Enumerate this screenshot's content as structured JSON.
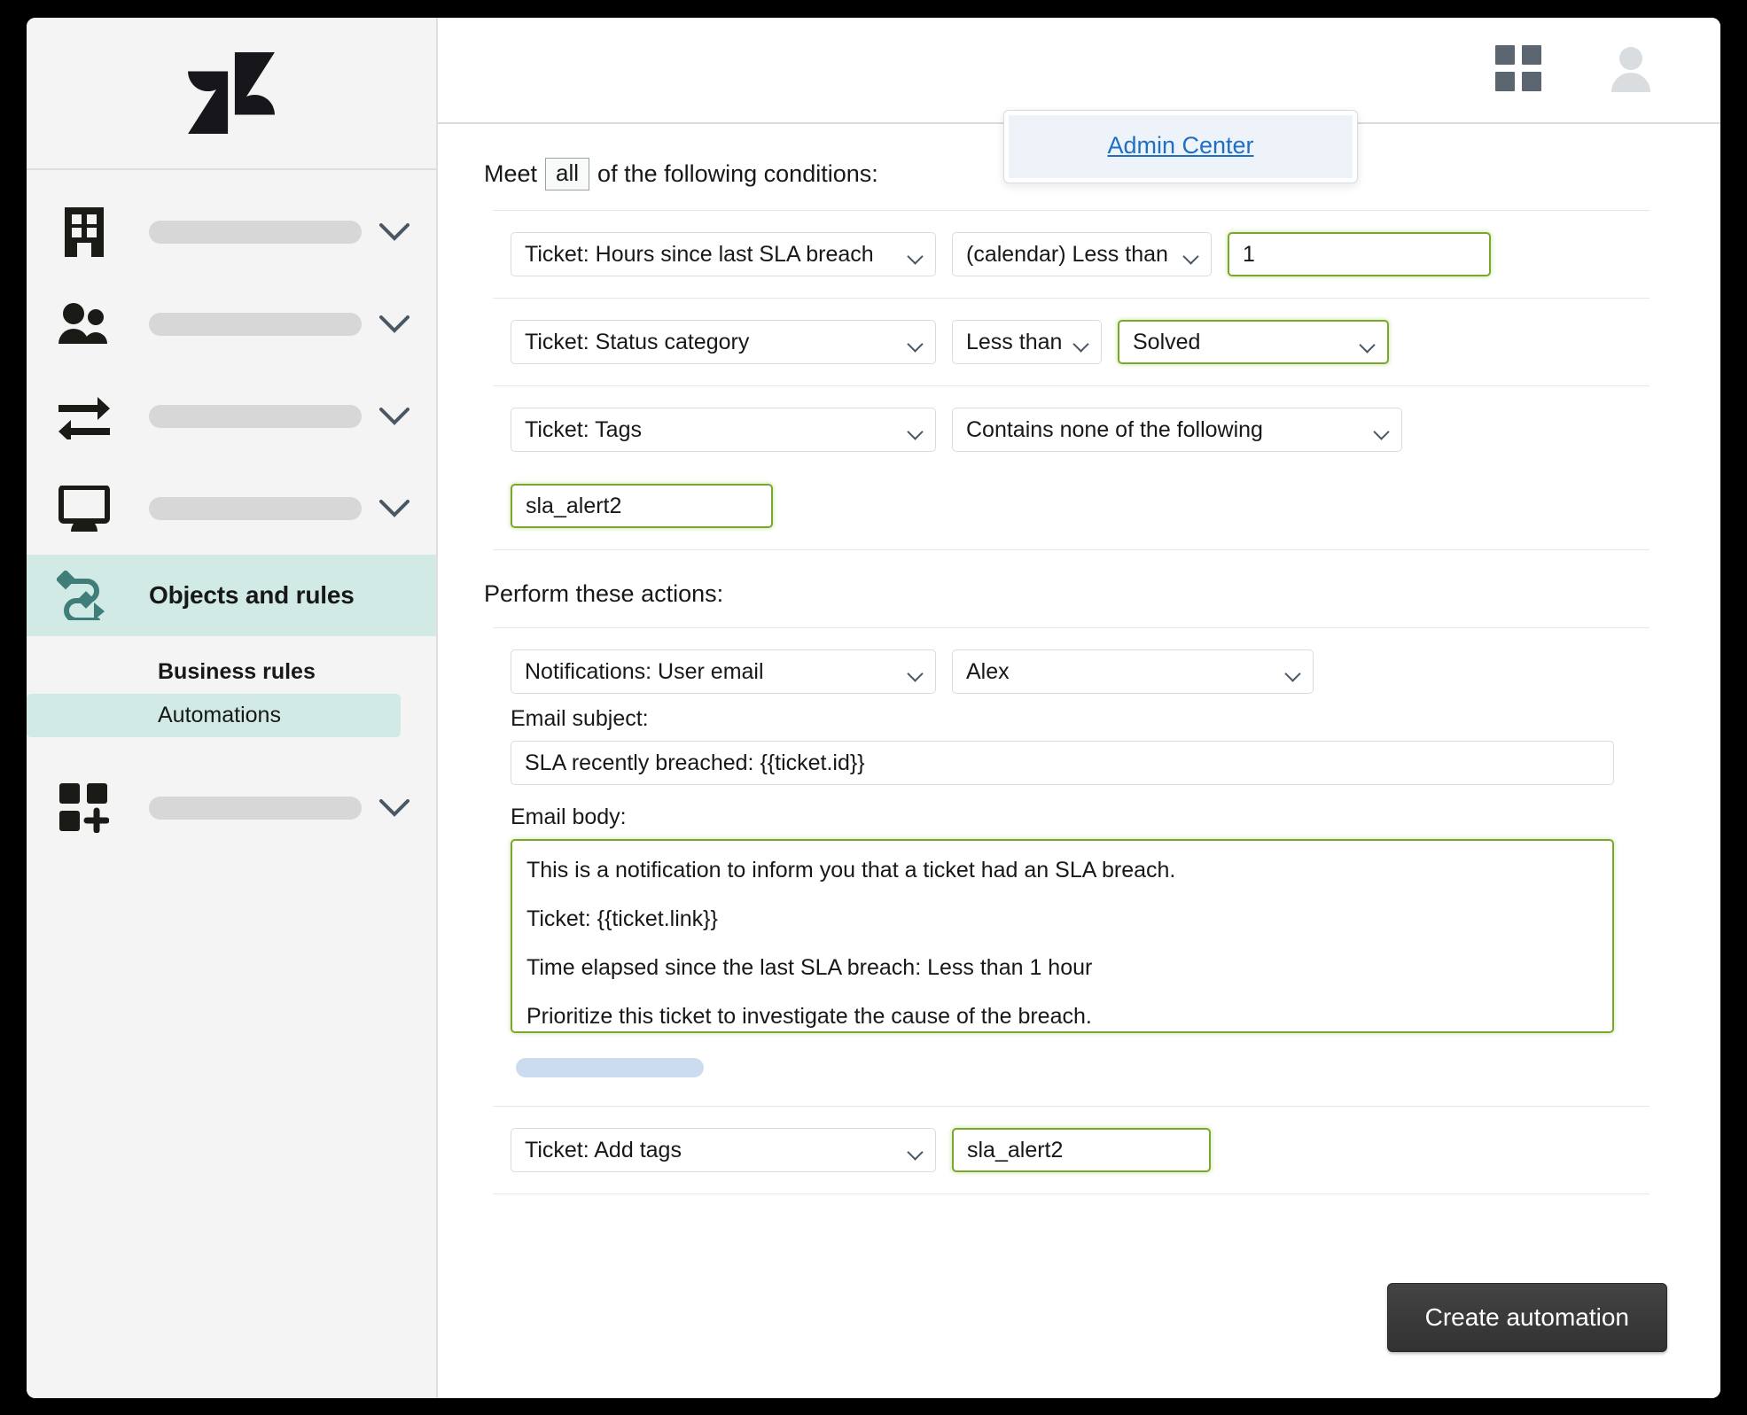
{
  "sidebar": {
    "logo": "zendesk-logo",
    "nav_items": [
      {
        "icon": "building-icon",
        "label": ""
      },
      {
        "icon": "people-icon",
        "label": ""
      },
      {
        "icon": "transfer-arrows-icon",
        "label": ""
      },
      {
        "icon": "monitor-icon",
        "label": ""
      }
    ],
    "active_item": {
      "icon": "objects-rules-icon",
      "label": "Objects and rules"
    },
    "subnav": [
      {
        "label": "Business rules",
        "selected": false
      },
      {
        "label": "Automations",
        "selected": true
      }
    ],
    "apps_item": {
      "icon": "apps-add-icon",
      "label": ""
    }
  },
  "topbar": {
    "grid_icon": "grid-apps-icon",
    "avatar_icon": "user-avatar-icon",
    "dropdown": {
      "link_label": "Admin Center"
    }
  },
  "conditions": {
    "heading_prefix": "Meet",
    "match_type": "all",
    "heading_suffix": "of the following conditions:",
    "rows": [
      {
        "field": "Ticket: Hours since last SLA breach",
        "operator": "(calendar) Less than",
        "value": "1",
        "value_highlighted": true
      },
      {
        "field": "Ticket: Status category",
        "operator": "Less than",
        "value": "Solved",
        "value_highlighted": true
      },
      {
        "field": "Ticket: Tags",
        "operator": "Contains none of the following",
        "value": "sla_alert2",
        "value_highlighted": true
      }
    ]
  },
  "actions": {
    "heading": "Perform these actions:",
    "notification": {
      "field": "Notifications: User email",
      "recipient": "Alex"
    },
    "email_subject_label": "Email subject:",
    "email_subject": "SLA recently breached: {{ticket.id}}",
    "email_body_label": "Email body:",
    "email_body_lines": [
      "This is a notification to inform you that a ticket had an SLA breach.",
      "Ticket: {{ticket.link}}",
      "Time elapsed since the last SLA breach: Less than 1 hour",
      "Prioritize this ticket to investigate the cause of the breach."
    ],
    "add_tags": {
      "field": "Ticket: Add tags",
      "value": "sla_alert2"
    }
  },
  "footer": {
    "submit_label": "Create automation"
  },
  "colors": {
    "accent_green": "#7aa82c",
    "active_teal": "#d2eae5",
    "link_blue": "#1f6fc4",
    "button_dark": "#3b3b3b"
  }
}
